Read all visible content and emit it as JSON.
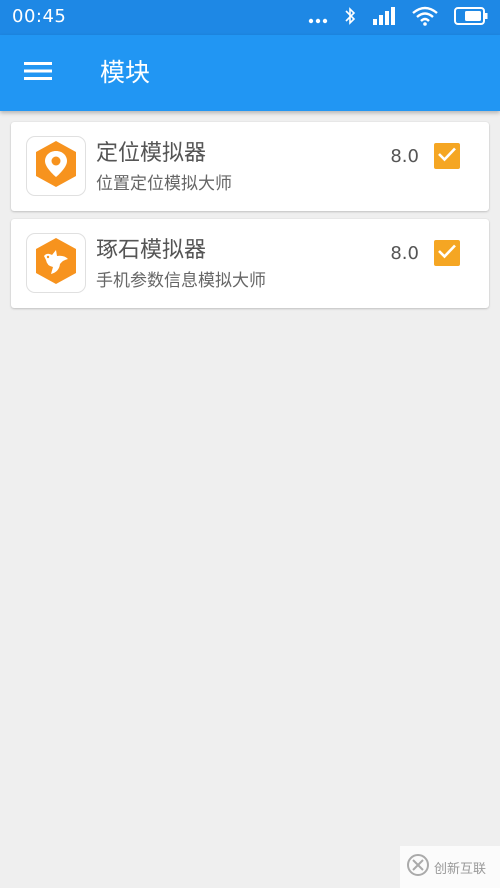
{
  "status_bar": {
    "time": "00:45",
    "icons": [
      "more-dots-icon",
      "bluetooth-icon",
      "cell-signal-icon",
      "wifi-icon",
      "battery-icon"
    ]
  },
  "app_bar": {
    "title": "模块",
    "menu_icon": "menu-icon"
  },
  "modules": [
    {
      "name": "定位模拟器",
      "description": "位置定位模拟大师",
      "version": "8.0",
      "enabled": true,
      "icon": "location-pin-icon"
    },
    {
      "name": "琢石模拟器",
      "description": "手机参数信息模拟大师",
      "version": "8.0",
      "enabled": true,
      "icon": "bird-icon"
    }
  ],
  "watermark": {
    "text": "创新互联",
    "icon": "logo-icon"
  },
  "colors": {
    "status_bar": "#1e88e5",
    "app_bar": "#2196f3",
    "accent_orange": "#f5a623",
    "icon_orange": "#f7931e",
    "background": "#efefef"
  }
}
